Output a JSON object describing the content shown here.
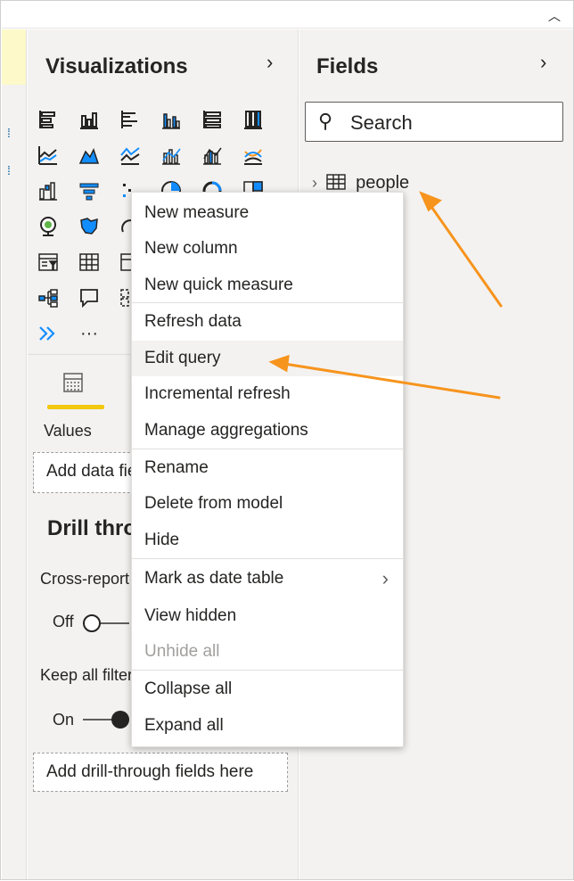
{
  "viz": {
    "title": "Visualizations",
    "chevron": "›"
  },
  "fields": {
    "title": "Fields",
    "chevron": "›",
    "search_placeholder": "Search",
    "table_name": "people"
  },
  "values": {
    "label": "Values",
    "add_data": "Add data fields here"
  },
  "drill": {
    "title": "Drill through",
    "cross_report": "Cross-report",
    "off": "Off",
    "keep_filters": "Keep all filters",
    "on": "On",
    "add_fields": "Add drill-through fields here"
  },
  "menu": {
    "items": [
      "New measure",
      "New column",
      "New quick measure",
      "Refresh data",
      "Edit query",
      "Incremental refresh",
      "Manage aggregations",
      "Rename",
      "Delete from model",
      "Hide",
      "Mark as date table",
      "View hidden",
      "Unhide all",
      "Collapse all",
      "Expand all"
    ]
  },
  "colors": {
    "accent_yellow": "#f2c811",
    "annotation_orange": "#f7941d"
  },
  "viz_icons": [
    "stacked-bar-icon",
    "stacked-column-icon",
    "clustered-bar-icon",
    "clustered-column-icon",
    "100pct-bar-icon",
    "100pct-column-icon",
    "line-chart-icon",
    "area-chart-icon",
    "stacked-area-icon",
    "line-column-icon",
    "line-clustered-column-icon",
    "ribbon-chart-icon",
    "waterfall-icon",
    "funnel-icon",
    "scatter-icon",
    "pie-icon",
    "donut-icon",
    "treemap-icon",
    "map-icon",
    "filled-map-icon",
    "gauge-icon",
    "slicer-icon",
    "table-icon",
    "matrix-icon",
    "decomposition-tree-icon",
    "qna-icon",
    "key-influencers-icon",
    "power-automate-icon",
    "more-visuals-icon"
  ]
}
